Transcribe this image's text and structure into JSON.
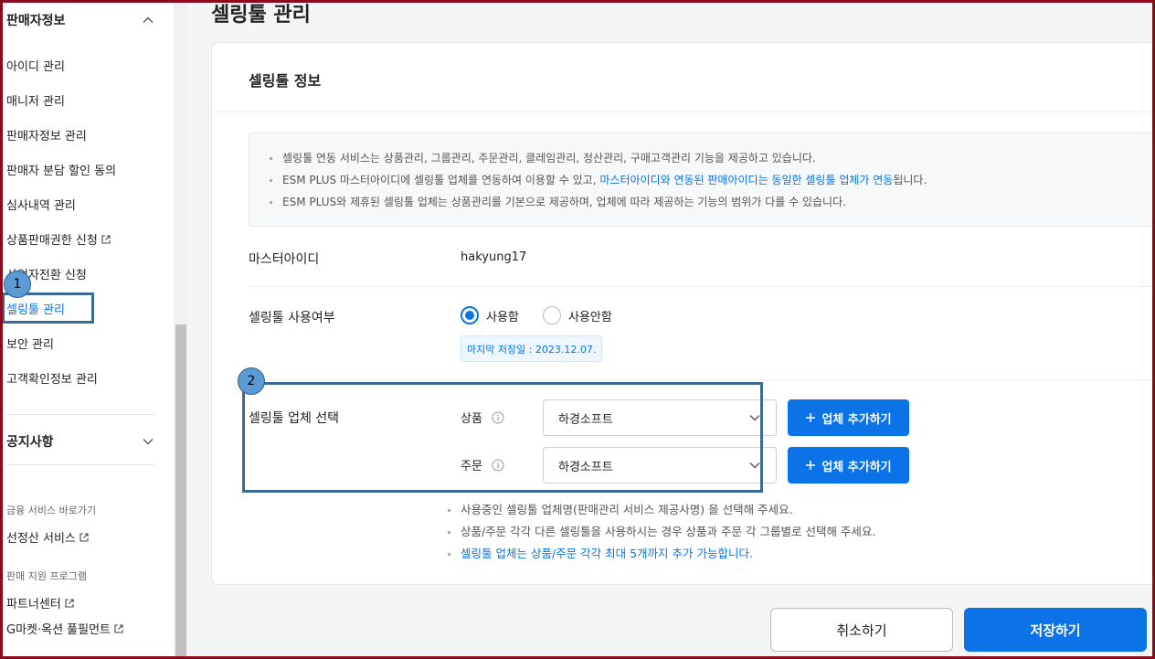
{
  "sidebar": {
    "section_seller": "판매자정보",
    "items": [
      {
        "label": "아이디 관리"
      },
      {
        "label": "매니저 관리"
      },
      {
        "label": "판매자정보 관리"
      },
      {
        "label": "판매자 분담 할인 동의"
      },
      {
        "label": "심사내역 관리"
      },
      {
        "label": "상품판매권한 신청"
      },
      {
        "label": "사업자전환 신청"
      },
      {
        "label": "셀링툴 관리"
      },
      {
        "label": "보안 관리"
      },
      {
        "label": "고객확인정보 관리"
      }
    ],
    "section_notice": "공지사항",
    "finance_title": "금융 서비스 바로가기",
    "finance_link": "선정산 서비스",
    "support_title": "판매 지원 프로그램",
    "support_links": [
      {
        "label": "파트너센터"
      },
      {
        "label": "G마켓·옥션 풀필먼트"
      }
    ]
  },
  "page": {
    "title": "셀링툴 관리",
    "card_title": "셀링툴 정보",
    "notice": {
      "line1": "셀링툴 연동 서비스는 상품관리, 그룹관리, 주문관리, 클레임관리, 정산관리, 구매고객관리 기능을 제공하고 있습니다.",
      "line2_prefix": "ESM PLUS 마스터아이디에 셀링툴 업체를 연동하여 이용할 수 있고, ",
      "line2_highlight": "마스터아이디와 연동된 판매아이디는 동일한 셀링툴 업체가 연동",
      "line2_suffix": "됩니다.",
      "line3": "ESM PLUS와 제휴된 셀링툴 업체는 상품관리를 기본으로 제공하며, 업체에 따라 제공하는 기능의 범위가 다를 수 있습니다."
    },
    "master_id_label": "마스터아이디",
    "master_id_value": "hakyung17",
    "usage_label": "셀링툴 사용여부",
    "radio_use": "사용함",
    "radio_nouse": "사용안함",
    "last_saved": "마지막 저장일 : 2023.12.07.",
    "vendor_label": "셀링툴 업체 선택",
    "product_label": "상품",
    "order_label": "주문",
    "product_vendor": "하경소프트",
    "order_vendor": "하경소프트",
    "add_vendor_label": "업체 추가하기",
    "guide": [
      "사용중인 셀링툴 업체명(판매관리 서비스 제공사명) 을 선택해 주세요.",
      "상품/주문 각각 다른 셀링툴을 사용하시는 경우 상품과 주문 각 그룹별로 선택해 주세요.",
      "셀링툴 업체는 상품/주문 각각 최대 5개까지 추가 가능합니다."
    ],
    "cancel_label": "취소하기",
    "save_label": "저장하기"
  },
  "annotations": {
    "badge1": "1",
    "badge2": "2"
  },
  "colors": {
    "accent": "#0b72e7",
    "frame": "#8b0a1e",
    "annotation": "#3b6a97"
  }
}
